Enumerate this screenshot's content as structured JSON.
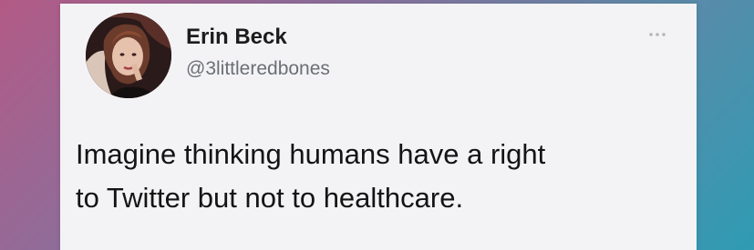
{
  "tweet": {
    "author_name": "Erin Beck",
    "author_handle": "@3littleredbones",
    "text_lines": [
      "Imagine thinking humans have a right",
      "to Twitter but not to healthcare."
    ]
  },
  "icons": {
    "more": "more-horizontal-icon",
    "avatar": "profile-photo"
  },
  "colors": {
    "card_background": "#f3f3f5",
    "name_text": "#1c1c1c",
    "handle_text": "#6b6f75",
    "body_text": "#141414"
  }
}
